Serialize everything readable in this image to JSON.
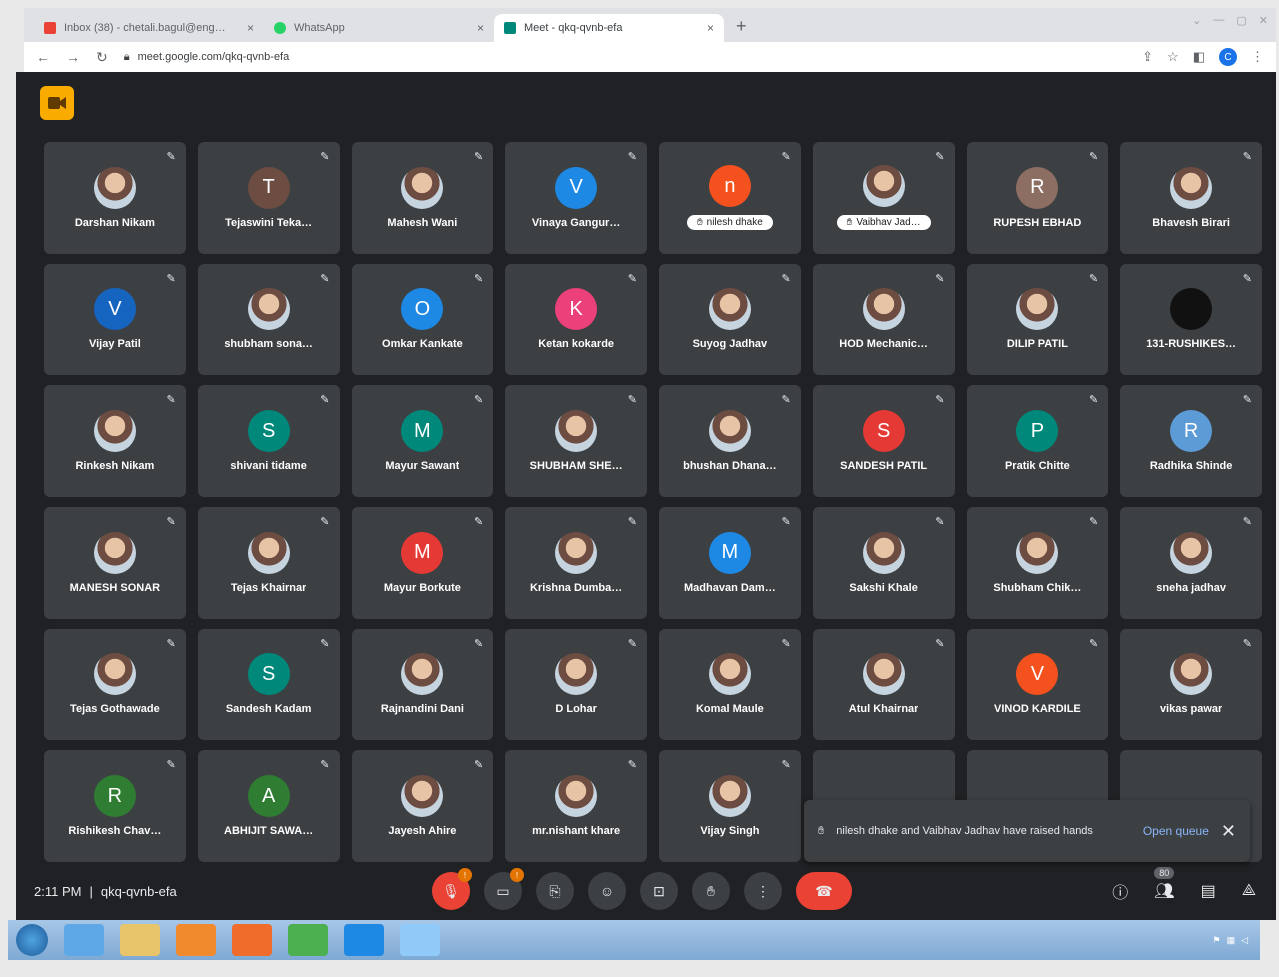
{
  "browser": {
    "tabs": [
      {
        "title": "Inbox (38) - chetali.bagul@eng…",
        "icon_color": "#ea4335",
        "close": "×"
      },
      {
        "title": "WhatsApp",
        "icon_color": "#25d366",
        "close": "×"
      },
      {
        "title": "Meet - qkq-qvnb-efa",
        "icon_color": "#00897b",
        "close": "×",
        "active": true
      }
    ],
    "new_tab": "+",
    "url": "meet.google.com/qkq-qvnb-efa",
    "profile_initial": "C"
  },
  "meet": {
    "participants": [
      {
        "name": "Darshan Nikam",
        "avatar": "photo"
      },
      {
        "name": "Tejaswini Teka…",
        "initial": "T",
        "color": "#6d4c41"
      },
      {
        "name": "Mahesh Wani",
        "avatar": "photo"
      },
      {
        "name": "Vinaya Gangur…",
        "initial": "V",
        "color": "#1e88e5"
      },
      {
        "name": "nilesh dhake",
        "initial": "n",
        "color": "#f4511e",
        "hand": true
      },
      {
        "name": "Vaibhav Jad…",
        "avatar": "photo",
        "hand": true
      },
      {
        "name": "RUPESH EBHAD",
        "initial": "R",
        "color": "#8d6e63"
      },
      {
        "name": "Bhavesh Birari",
        "avatar": "photo"
      },
      {
        "name": "Vijay Patil",
        "initial": "V",
        "color": "#1565c0"
      },
      {
        "name": "shubham sona…",
        "avatar": "photo"
      },
      {
        "name": "Omkar Kankate",
        "initial": "O",
        "color": "#1e88e5"
      },
      {
        "name": "Ketan kokarde",
        "initial": "K",
        "color": "#ec407a"
      },
      {
        "name": "Suyog Jadhav",
        "avatar": "photo"
      },
      {
        "name": "HOD Mechanic…",
        "avatar": "photo"
      },
      {
        "name": "DILIP PATIL",
        "avatar": "photo"
      },
      {
        "name": "131-RUSHIKES…",
        "initial": "",
        "color": "#111111"
      },
      {
        "name": "Rinkesh Nikam",
        "avatar": "photo"
      },
      {
        "name": "shivani tidame",
        "initial": "S",
        "color": "#00897b"
      },
      {
        "name": "Mayur Sawant",
        "initial": "M",
        "color": "#00897b"
      },
      {
        "name": "SHUBHAM SHE…",
        "avatar": "photo"
      },
      {
        "name": "bhushan Dhana…",
        "avatar": "photo"
      },
      {
        "name": "SANDESH PATIL",
        "initial": "S",
        "color": "#e53935"
      },
      {
        "name": "Pratik Chitte",
        "initial": "P",
        "color": "#00897b"
      },
      {
        "name": "Radhika Shinde",
        "initial": "R",
        "color": "#5c9bd6"
      },
      {
        "name": "MANESH SONAR",
        "avatar": "photo"
      },
      {
        "name": "Tejas Khairnar",
        "avatar": "photo"
      },
      {
        "name": "Mayur Borkute",
        "initial": "M",
        "color": "#e53935"
      },
      {
        "name": "Krishna Dumba…",
        "avatar": "photo"
      },
      {
        "name": "Madhavan Dam…",
        "initial": "M",
        "color": "#1e88e5"
      },
      {
        "name": "Sakshi Khale",
        "avatar": "photo"
      },
      {
        "name": "Shubham Chik…",
        "avatar": "photo"
      },
      {
        "name": "sneha jadhav",
        "avatar": "photo"
      },
      {
        "name": "Tejas Gothawade",
        "avatar": "photo"
      },
      {
        "name": "Sandesh Kadam",
        "initial": "S",
        "color": "#00897b"
      },
      {
        "name": "Rajnandini Dani",
        "avatar": "photo"
      },
      {
        "name": "D Lohar",
        "avatar": "photo"
      },
      {
        "name": "Komal Maule",
        "avatar": "photo"
      },
      {
        "name": "Atul Khairnar",
        "avatar": "photo"
      },
      {
        "name": "VINOD KARDILE",
        "initial": "V",
        "color": "#f4511e"
      },
      {
        "name": "vikas pawar",
        "avatar": "photo"
      },
      {
        "name": "Rishikesh Chav…",
        "initial": "R",
        "color": "#2e7d32"
      },
      {
        "name": "ABHIJIT SAWA…",
        "initial": "A",
        "color": "#2e7d32"
      },
      {
        "name": "Jayesh Ahire",
        "avatar": "photo"
      },
      {
        "name": "mr.nishant khare",
        "avatar": "photo"
      },
      {
        "name": "Vijay Singh",
        "avatar": "photo"
      }
    ],
    "toast": {
      "message": "nilesh dhake and Vaibhav Jadhav have raised hands",
      "link": "Open queue",
      "close": "✕"
    },
    "time": "2:11 PM",
    "separator": "|",
    "meeting_code": "qkq-qvnb-efa",
    "mic_badge": "!",
    "cam_badge": "!",
    "participant_count": "80"
  }
}
